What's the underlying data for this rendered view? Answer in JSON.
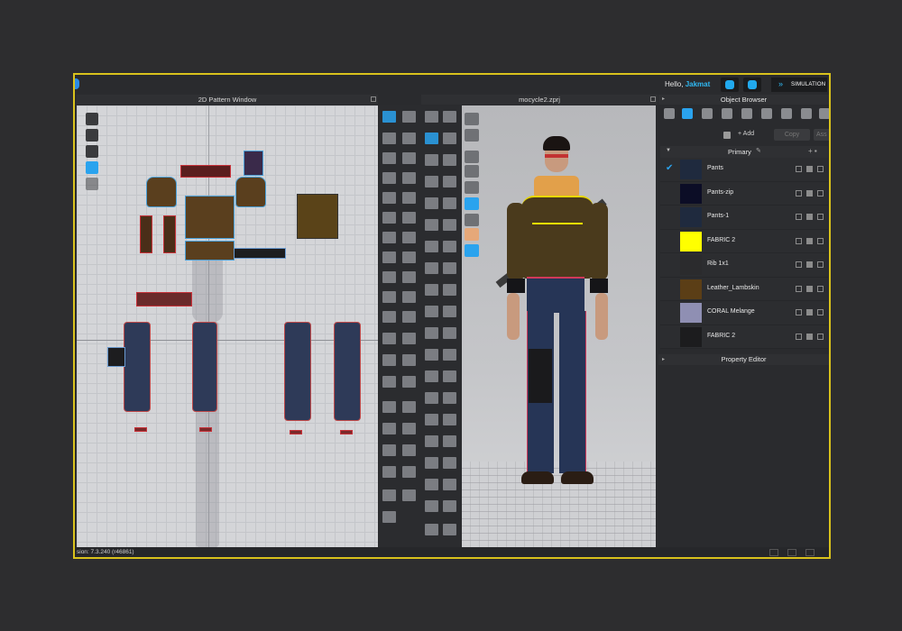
{
  "topbar": {
    "greeting": "Hello,",
    "username": "Jakmat",
    "simulation_label": "SIMULATION"
  },
  "pattern_window": {
    "title": "2D Pattern Window"
  },
  "viewport_3d": {
    "title": "mocycle2.zprj"
  },
  "object_browser": {
    "title": "Object Browser",
    "add_label": "+ Add",
    "copy_label": "Copy",
    "assign_label": "Ass",
    "group_label": "Primary",
    "fabrics": [
      {
        "name": "Pants",
        "color": "#1f2a3e",
        "selected": true
      },
      {
        "name": "Pants-zip",
        "color": "#0c0d26",
        "selected": false
      },
      {
        "name": "Pants-1",
        "color": "#1f2a3e",
        "selected": false
      },
      {
        "name": "FABRIC 2",
        "color": "#ffff00",
        "selected": false
      },
      {
        "name": "Rib 1x1",
        "color": "#2b2b2d",
        "selected": false
      },
      {
        "name": "Leather_Lambskin",
        "color": "#5b3e16",
        "selected": false
      },
      {
        "name": "CORAL Melange",
        "color": "#8f8fb3",
        "selected": false
      },
      {
        "name": "FABRIC 2",
        "color": "#1c1c1e",
        "selected": false
      }
    ]
  },
  "property_editor": {
    "title": "Property Editor"
  },
  "statusbar": {
    "version": "sion: 7.3.240 (r46861)"
  },
  "colors": {
    "accent": "#2aa3ee",
    "frame": "#d9c21c"
  }
}
